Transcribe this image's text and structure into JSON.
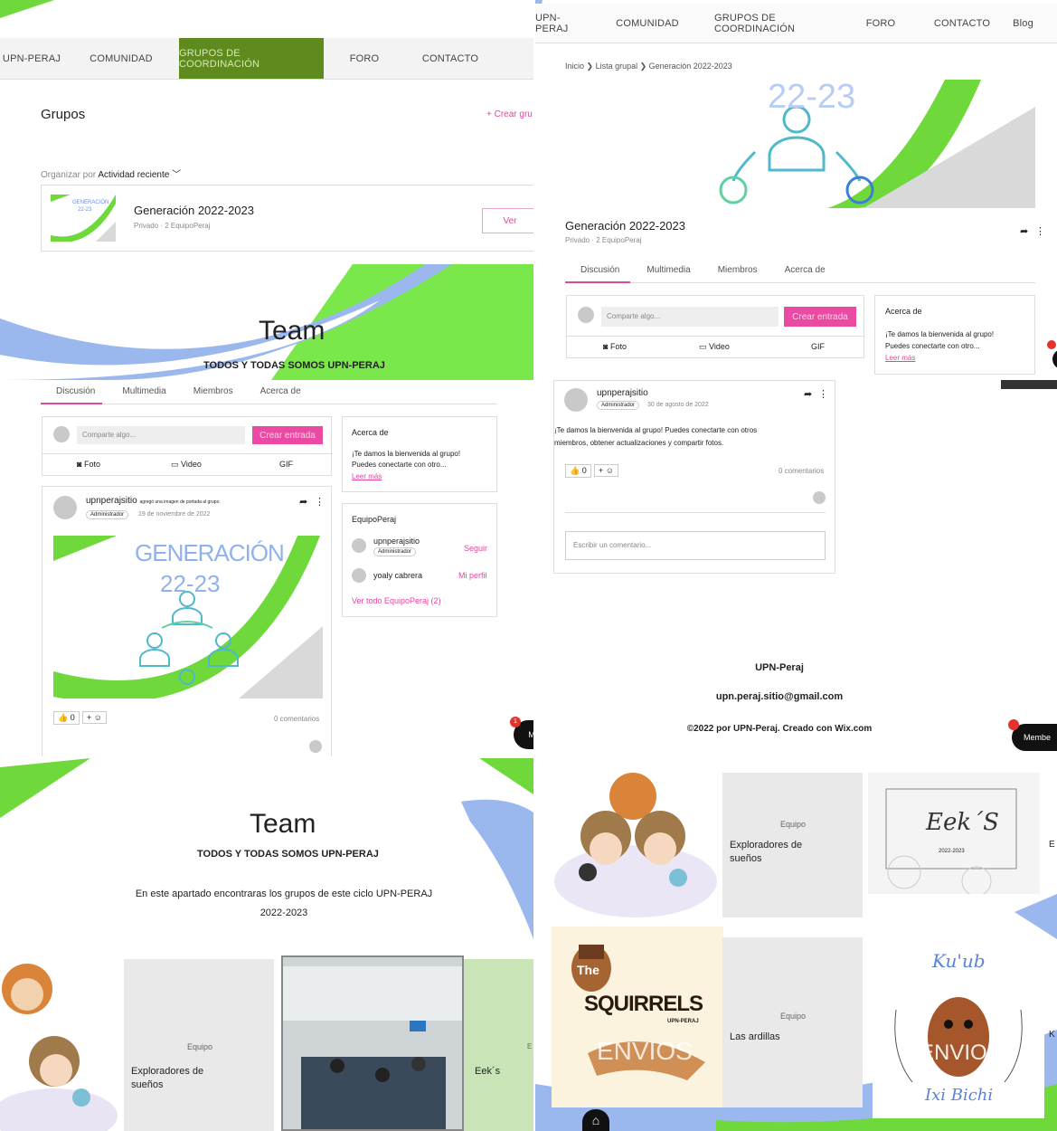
{
  "nav_left": {
    "items": [
      "UPN-PERAJ",
      "COMUNIDAD",
      "GRUPOS DE COORDINACIÓN",
      "FORO",
      "CONTACTO"
    ]
  },
  "nav_right": {
    "items": [
      "UPN-PERAJ",
      "COMUNIDAD",
      "GRUPOS DE COORDINACIÓN",
      "FORO",
      "CONTACTO",
      "Blog"
    ]
  },
  "groups_page": {
    "title": "Grupos",
    "create_label": "+ Crear gru",
    "sort_prefix": "Organizar por",
    "sort_value": "Actividad reciente",
    "group_name": "Generación 2022-2023",
    "group_meta": "Privado · 2 EquipoPeraj",
    "view_label": "Ver",
    "thumb_text_1": "GENERACIÓN",
    "thumb_text_2": "22-23"
  },
  "team_banner": {
    "title": "Team",
    "subtitle": "TODOS Y TODAS SOMOS UPN-PERAJ"
  },
  "tabs": [
    "Discusión",
    "Multimedia",
    "Miembros",
    "Acerca de"
  ],
  "composer": {
    "placeholder": "Comparte algo...",
    "create_label": "Crear entrada",
    "photo": "Foto",
    "video": "Video",
    "gif": "GIF"
  },
  "about": {
    "title": "Acerca de",
    "text_1": "¡Te damos la bienvenida al grupo!",
    "text_2": "Puedes conectarte con otro...",
    "more": "Leer más"
  },
  "members_box": {
    "title": "EquipoPeraj",
    "m1_name": "upnperajsitio",
    "m1_role": "Administrador",
    "m1_action": "Seguir",
    "m2_name": "yoaly cabrera",
    "m2_action": "Mi perfil",
    "view_all": "Ver todo EquipoPeraj (2)"
  },
  "post1": {
    "author": "upnperajsitio",
    "action": "agregó una imagen de portada al grupo.",
    "role": "Administrador",
    "date": "19 de noviembre de 2022",
    "image_text_1": "GENERACIÓN",
    "image_text_2": "22-23",
    "likes": "0",
    "comments": "0 comentarios"
  },
  "group_detail": {
    "breadcrumb": [
      "Inicio",
      "Lista grupal",
      "Generación 2022-2023"
    ],
    "cover_text": "22-23",
    "name": "Generación 2022-2023",
    "meta": "Privado · 2 EquipoPeraj"
  },
  "post2": {
    "author": "upnperajsitio",
    "role": "Administrador",
    "date": "30 de agosto de 2022",
    "text_1": "¡Te damos la bienvenida al grupo! Puedes conectarte con otros",
    "text_2": "miembros, obtener actualizaciones y compartir fotos.",
    "likes": "0",
    "comments": "0 comentarios",
    "comment_placeholder": "Escribir un comentario..."
  },
  "footer": {
    "name": "UPN-Peraj",
    "email": "upn.peraj.sitio@gmail.com",
    "copyright": "©2022 por UPN-Peraj. Creado con Wix.com",
    "members_label": "Membe",
    "members_short": "M",
    "badge": "1"
  },
  "team_page": {
    "title": "Team",
    "subtitle": "TODOS Y TODAS SOMOS UPN-PERAJ",
    "intro_1": "En este apartado encontraras los grupos de este ciclo UPN-PERAJ",
    "intro_2": "2022-2023",
    "card1_label": "Equipo",
    "card1_name_1": "Exploradores de",
    "card1_name_2": "sueños",
    "card2_name": "Eek´s",
    "card2_partial": "E"
  },
  "teams_grid": {
    "card1_label": "Equipo",
    "card1_name_1": "Exploradores de",
    "card1_name_2": "sueños",
    "eeks_logo": "Eek´S",
    "eeks_sub": "2022-2023",
    "squirrels_the": "The",
    "squirrels_word": "SQUIRRELS",
    "squirrels_sub": "UPN-PERAJ",
    "squirrels_watermark": "ENVIOS",
    "card3_label": "Equipo",
    "card3_name": "Las ardillas",
    "kuub_logo": "Ku'ub",
    "kuub_watermark": "ENVIO",
    "kuub_sub": "Ixi Bichi",
    "right_edge_1": "E",
    "right_edge_2": "K"
  },
  "colors": {
    "accent_green": "#5f8a1e",
    "lime": "#7ae84a",
    "blue": "#9ab7ee",
    "pink": "#ea4aa2"
  }
}
